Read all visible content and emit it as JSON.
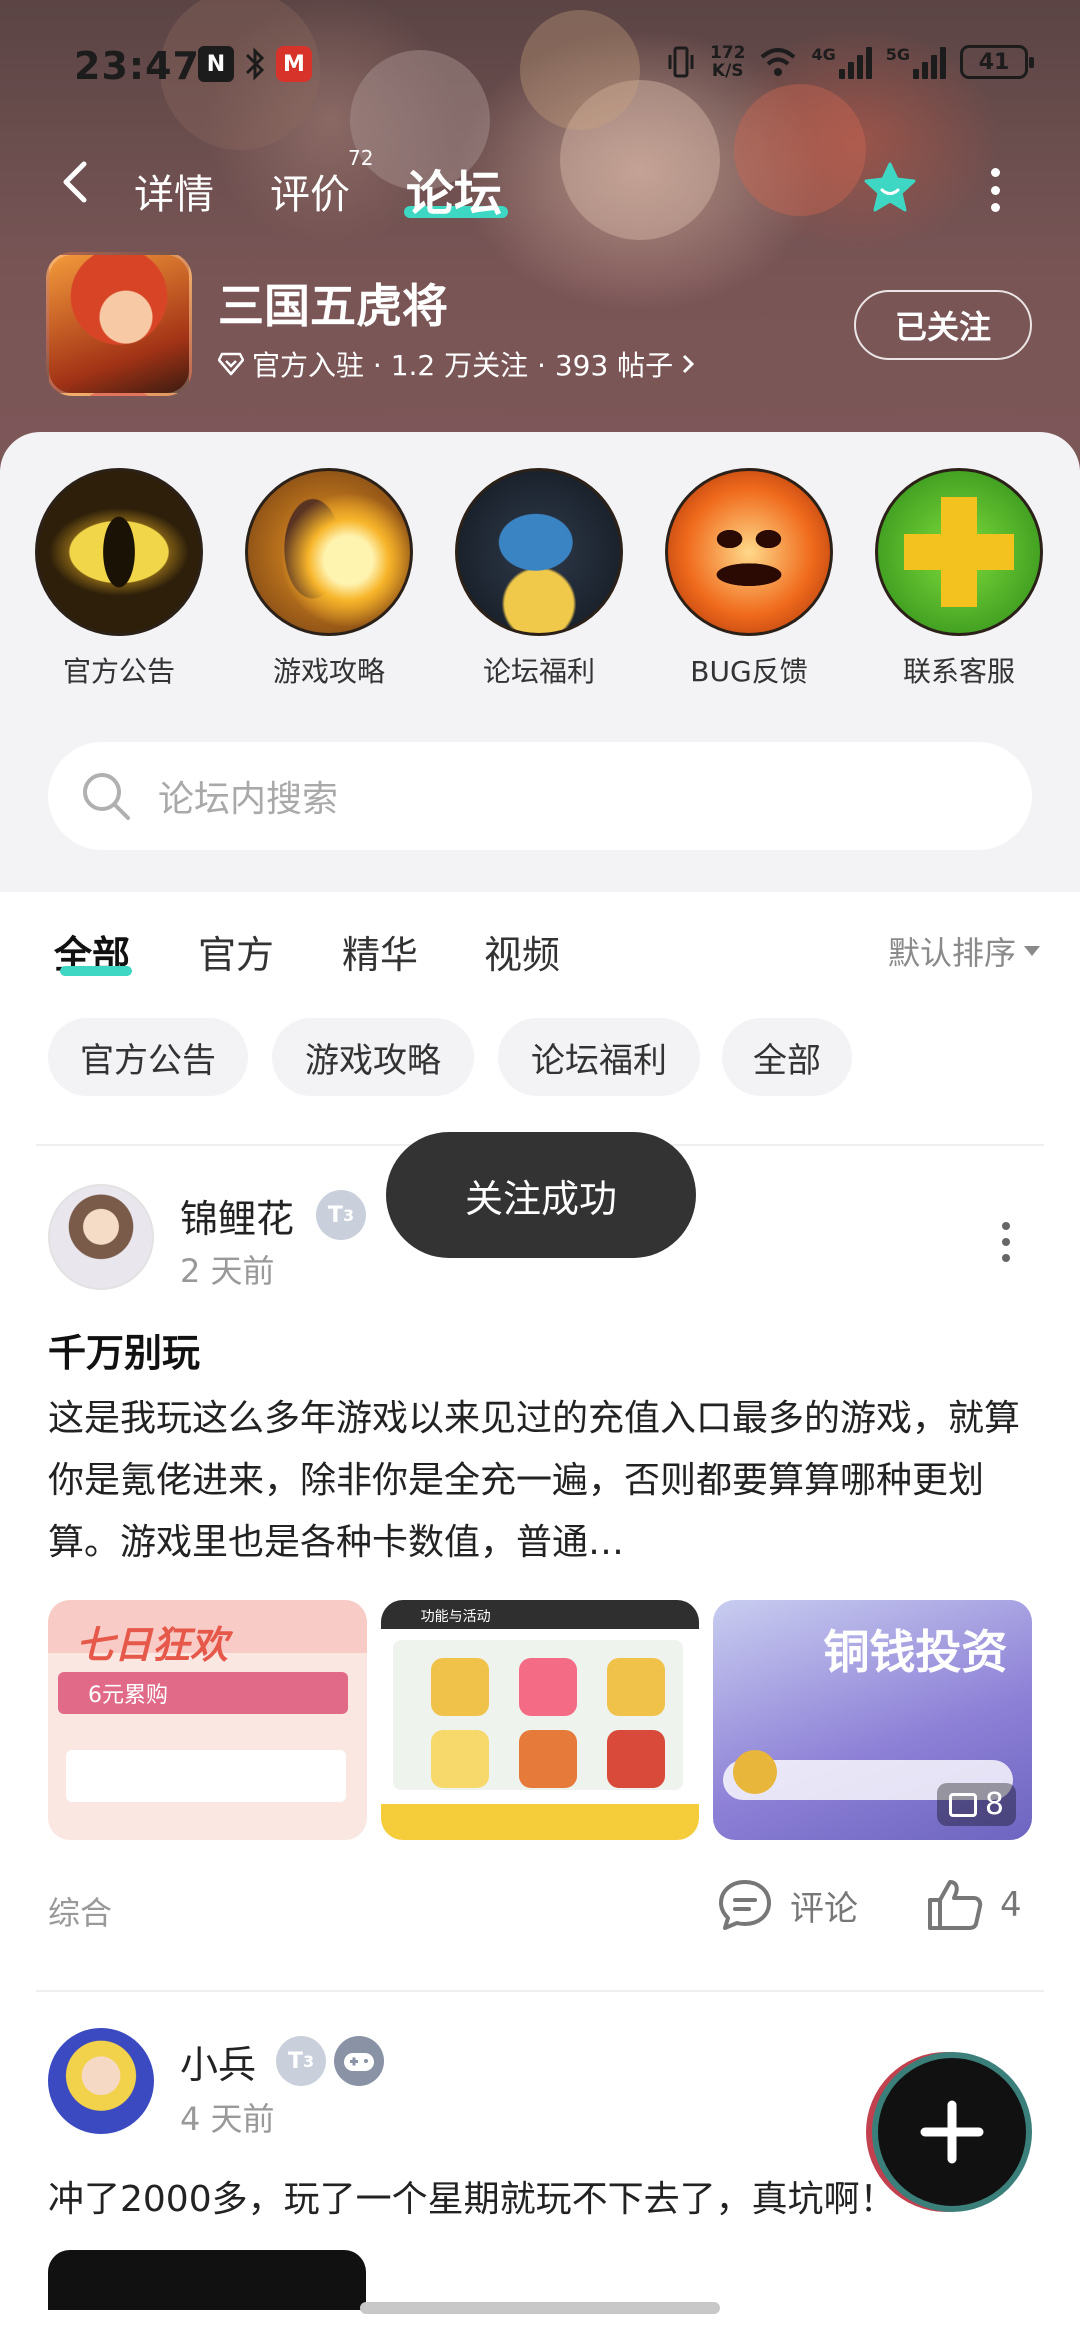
{
  "status_bar": {
    "time": "23:47",
    "net_speed_value": "172",
    "net_speed_unit": "K/S",
    "sig1_label": "4G",
    "sig2_label": "5G",
    "battery": "41"
  },
  "nav": {
    "tabs": [
      {
        "label": "详情"
      },
      {
        "label": "评价",
        "badge": "72"
      },
      {
        "label": "论坛"
      }
    ],
    "active_tab": "论坛"
  },
  "game": {
    "name": "三国五虎将",
    "meta": "官方入驻 · 1.2 万关注 · 393 帖子",
    "follow_label": "已关注"
  },
  "shortcuts": [
    {
      "label": "官方公告",
      "icon": "dragon-eye-icon"
    },
    {
      "label": "游戏攻略",
      "icon": "torch-hand-icon"
    },
    {
      "label": "论坛福利",
      "icon": "gift-fist-icon"
    },
    {
      "label": "BUG反馈",
      "icon": "pumpkin-icon"
    },
    {
      "label": "联系客服",
      "icon": "green-cross-icon"
    }
  ],
  "search": {
    "placeholder": "论坛内搜索"
  },
  "filters": {
    "tabs": [
      {
        "label": "全部"
      },
      {
        "label": "官方"
      },
      {
        "label": "精华"
      },
      {
        "label": "视频"
      }
    ],
    "active": "全部",
    "sort_label": "默认排序"
  },
  "chips": [
    {
      "label": "官方公告"
    },
    {
      "label": "游戏攻略"
    },
    {
      "label": "论坛福利"
    },
    {
      "label": "全部"
    }
  ],
  "toast": "关注成功",
  "posts": [
    {
      "user": "锦鲤花",
      "level": "3",
      "date": "2 天前",
      "title": "千万别玩",
      "body": "这是我玩这么多年游戏以来见过的充值入口最多的游戏，就算你是氪佬进来，除非你是全充一遍，否则都要算算哪种更划算。游戏里也是各种卡数值，普通…",
      "images": [
        {
          "title": "七日狂欢",
          "bar": "6元累购"
        },
        {
          "title": "功能与活动"
        },
        {
          "title": "铜钱投资"
        }
      ],
      "image_count": "8",
      "category": "综合",
      "comment_label": "评论",
      "likes": "4"
    },
    {
      "user": "小兵",
      "level": "3",
      "date": "4 天前",
      "body": "冲了2000多，玩了一个星期就玩不下去了，真坑啊！"
    }
  ],
  "colors": {
    "accent": "#3ed7c4",
    "toast_bg": "#333333",
    "page_bg": "#ffffff",
    "card_bg": "#f3f3f5"
  }
}
